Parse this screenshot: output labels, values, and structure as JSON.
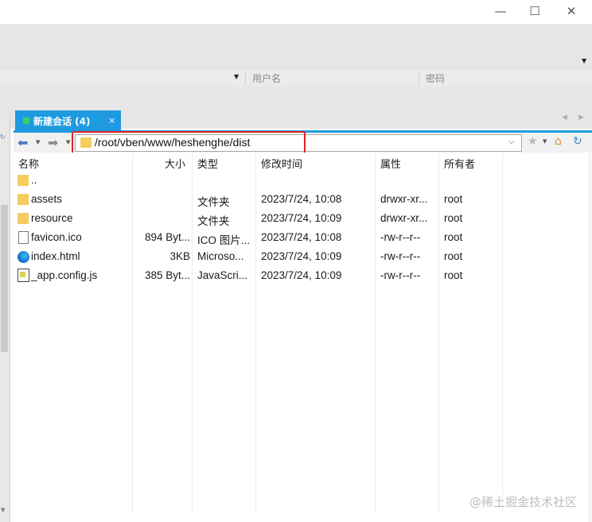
{
  "window": {
    "minimize_glyph": "—",
    "maximize_glyph": "☐",
    "close_glyph": "✕"
  },
  "connection": {
    "username_placeholder": "用户名",
    "password_placeholder": "密码"
  },
  "session_tab": {
    "label": "新建会话 (4)",
    "close_glyph": "×"
  },
  "address": {
    "path": "/root/vben/www/heshenghe/dist"
  },
  "columns": [
    "名称",
    "大小",
    "类型",
    "修改时间",
    "属性",
    "所有者"
  ],
  "files": [
    {
      "icon": "folder-icon",
      "name": "..",
      "size": "",
      "type": "",
      "modified": "",
      "attributes": "",
      "owner": ""
    },
    {
      "icon": "folder-icon",
      "name": "assets",
      "size": "",
      "type": "文件夹",
      "modified": "2023/7/24, 10:08",
      "attributes": "drwxr-xr...",
      "owner": "root"
    },
    {
      "icon": "folder-icon",
      "name": "resource",
      "size": "",
      "type": "文件夹",
      "modified": "2023/7/24, 10:09",
      "attributes": "drwxr-xr...",
      "owner": "root"
    },
    {
      "icon": "file-icon",
      "name": "favicon.ico",
      "size": "894 Byt...",
      "type": "ICO 图片...",
      "modified": "2023/7/24, 10:08",
      "attributes": "-rw-r--r--",
      "owner": "root"
    },
    {
      "icon": "edge-icon",
      "name": "index.html",
      "size": "3KB",
      "type": "Microso...",
      "modified": "2023/7/24, 10:09",
      "attributes": "-rw-r--r--",
      "owner": "root"
    },
    {
      "icon": "js-file-icon",
      "name": "_app.config.js",
      "size": "385 Byt...",
      "type": "JavaScri...",
      "modified": "2023/7/24, 10:09",
      "attributes": "-rw-r--r--",
      "owner": "root"
    }
  ],
  "watermark": "@稀土掘金技术社区",
  "colors": {
    "tab_active": "#1e9ae0",
    "session_dot": "#36d65c",
    "highlight_border": "#e02424",
    "folder": "#f3cd60"
  }
}
